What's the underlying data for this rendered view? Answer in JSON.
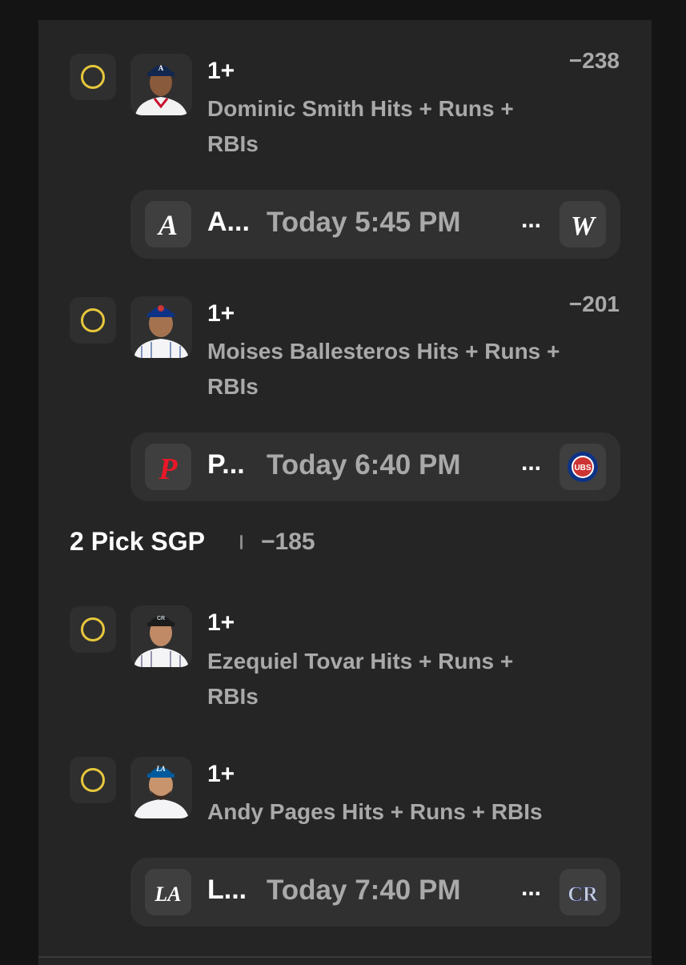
{
  "colors": {
    "background": "#141414",
    "card": "#252525",
    "game_bar": "#303030",
    "check_ring": "#e7c73c",
    "muted_text": "#a9a9a9",
    "primary_text": "#ffffff"
  },
  "picks": [
    {
      "line": "1+",
      "market": "Dominic Smith Hits + Runs + RBIs",
      "odds": "−238",
      "avatar_icon": "player-headshot-braves-icon"
    },
    {
      "line": "1+",
      "market": "Moises Ballesteros Hits + Runs + RBIs",
      "odds": "−201",
      "avatar_icon": "player-headshot-cubs-icon"
    },
    {
      "line": "1+",
      "market": "Ezequiel Tovar Hits + Runs + RBIs",
      "avatar_icon": "player-headshot-rockies-icon"
    },
    {
      "line": "1+",
      "market": "Andy Pages Hits + Runs + RBIs",
      "avatar_icon": "player-headshot-dodgers-icon"
    }
  ],
  "games": [
    {
      "away_abbr": "A...",
      "time": "Today 5:45 PM",
      "more": "...",
      "away_logo_icon": "braves-logo-icon",
      "home_logo_icon": "nationals-logo-icon"
    },
    {
      "away_abbr": "P...",
      "time": "Today 6:40 PM",
      "more": "...",
      "away_logo_icon": "phillies-logo-icon",
      "home_logo_icon": "cubs-logo-icon"
    },
    {
      "away_abbr": "L...",
      "time": "Today 7:40 PM",
      "more": "...",
      "away_logo_icon": "dodgers-logo-icon",
      "home_logo_icon": "rockies-logo-icon"
    }
  ],
  "sgp": {
    "label": "2 Pick SGP",
    "odds": "−185"
  }
}
